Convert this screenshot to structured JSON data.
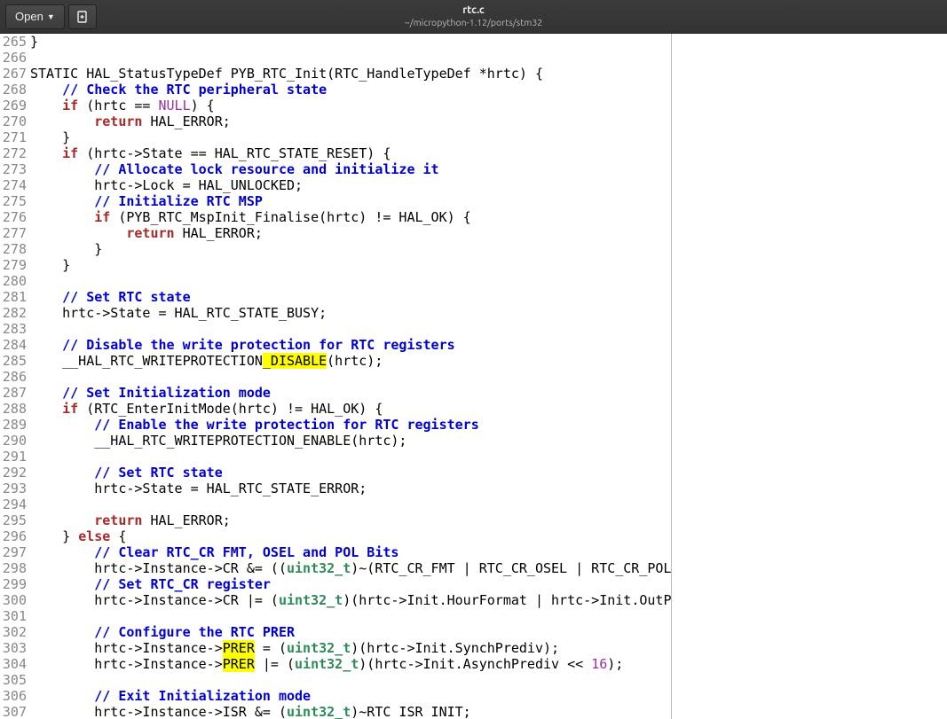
{
  "header": {
    "open_label": "Open",
    "filename": "rtc.c",
    "filepath": "~/micropython-1.12/ports/stm32"
  },
  "lines": [
    {
      "n": "265",
      "segs": [
        {
          "t": "}"
        }
      ]
    },
    {
      "n": "266",
      "segs": []
    },
    {
      "n": "267",
      "segs": [
        {
          "t": "STATIC HAL_StatusTypeDef PYB_RTC_Init(RTC_HandleTypeDef *hrtc) {"
        }
      ]
    },
    {
      "n": "268",
      "segs": [
        {
          "t": "    "
        },
        {
          "t": "// Check the RTC peripheral state",
          "c": "comment"
        }
      ]
    },
    {
      "n": "269",
      "segs": [
        {
          "t": "    "
        },
        {
          "t": "if",
          "c": "kw"
        },
        {
          "t": " (hrtc == "
        },
        {
          "t": "NULL",
          "c": "null"
        },
        {
          "t": ") {"
        }
      ]
    },
    {
      "n": "270",
      "segs": [
        {
          "t": "        "
        },
        {
          "t": "return",
          "c": "ret"
        },
        {
          "t": " HAL_ERROR;"
        }
      ]
    },
    {
      "n": "271",
      "segs": [
        {
          "t": "    }"
        }
      ]
    },
    {
      "n": "272",
      "segs": [
        {
          "t": "    "
        },
        {
          "t": "if",
          "c": "kw"
        },
        {
          "t": " (hrtc->State == HAL_RTC_STATE_RESET) {"
        }
      ]
    },
    {
      "n": "273",
      "segs": [
        {
          "t": "        "
        },
        {
          "t": "// Allocate lock resource and initialize it",
          "c": "comment"
        }
      ]
    },
    {
      "n": "274",
      "segs": [
        {
          "t": "        hrtc->Lock = HAL_UNLOCKED;"
        }
      ]
    },
    {
      "n": "275",
      "segs": [
        {
          "t": "        "
        },
        {
          "t": "// Initialize RTC MSP",
          "c": "comment"
        }
      ]
    },
    {
      "n": "276",
      "segs": [
        {
          "t": "        "
        },
        {
          "t": "if",
          "c": "kw"
        },
        {
          "t": " (PYB_RTC_MspInit_Finalise(hrtc) != HAL_OK) {"
        }
      ]
    },
    {
      "n": "277",
      "segs": [
        {
          "t": "            "
        },
        {
          "t": "return",
          "c": "ret"
        },
        {
          "t": " HAL_ERROR;"
        }
      ]
    },
    {
      "n": "278",
      "segs": [
        {
          "t": "        }"
        }
      ]
    },
    {
      "n": "279",
      "segs": [
        {
          "t": "    }"
        }
      ]
    },
    {
      "n": "280",
      "segs": []
    },
    {
      "n": "281",
      "segs": [
        {
          "t": "    "
        },
        {
          "t": "// Set RTC state",
          "c": "comment"
        }
      ]
    },
    {
      "n": "282",
      "segs": [
        {
          "t": "    hrtc->State = HAL_RTC_STATE_BUSY;"
        }
      ]
    },
    {
      "n": "283",
      "segs": []
    },
    {
      "n": "284",
      "segs": [
        {
          "t": "    "
        },
        {
          "t": "// Disable the write protection for RTC registers",
          "c": "comment"
        }
      ]
    },
    {
      "n": "285",
      "segs": [
        {
          "t": "    __HAL_RTC_WRITEPROTECTION"
        },
        {
          "t": "_DISABLE",
          "c": "hl"
        },
        {
          "t": "(hrtc);"
        }
      ]
    },
    {
      "n": "286",
      "segs": []
    },
    {
      "n": "287",
      "segs": [
        {
          "t": "    "
        },
        {
          "t": "// Set Initialization mode",
          "c": "comment"
        }
      ]
    },
    {
      "n": "288",
      "segs": [
        {
          "t": "    "
        },
        {
          "t": "if",
          "c": "kw"
        },
        {
          "t": " (RTC_EnterInitMode(hrtc) != HAL_OK) {"
        }
      ]
    },
    {
      "n": "289",
      "segs": [
        {
          "t": "        "
        },
        {
          "t": "// Enable the write protection for RTC registers",
          "c": "comment"
        }
      ]
    },
    {
      "n": "290",
      "segs": [
        {
          "t": "        __HAL_RTC_WRITEPROTECTION_ENABLE(hrtc);"
        }
      ]
    },
    {
      "n": "291",
      "segs": []
    },
    {
      "n": "292",
      "segs": [
        {
          "t": "        "
        },
        {
          "t": "// Set RTC state",
          "c": "comment"
        }
      ]
    },
    {
      "n": "293",
      "segs": [
        {
          "t": "        hrtc->State = HAL_RTC_STATE_ERROR;"
        }
      ]
    },
    {
      "n": "294",
      "segs": []
    },
    {
      "n": "295",
      "segs": [
        {
          "t": "        "
        },
        {
          "t": "return",
          "c": "ret"
        },
        {
          "t": " HAL_ERROR;"
        }
      ]
    },
    {
      "n": "296",
      "segs": [
        {
          "t": "    } "
        },
        {
          "t": "else",
          "c": "kw"
        },
        {
          "t": " {"
        }
      ]
    },
    {
      "n": "297",
      "segs": [
        {
          "t": "        "
        },
        {
          "t": "// Clear RTC_CR FMT, OSEL and POL Bits",
          "c": "comment"
        }
      ]
    },
    {
      "n": "298",
      "segs": [
        {
          "t": "        hrtc->Instance->CR &= (("
        },
        {
          "t": "uint32_t",
          "c": "type"
        },
        {
          "t": ")~(RTC_CR_FMT | RTC_CR_OSEL | RTC_CR_POL));"
        }
      ]
    },
    {
      "n": "299",
      "segs": [
        {
          "t": "        "
        },
        {
          "t": "// Set RTC_CR register",
          "c": "comment"
        }
      ]
    },
    {
      "n": "300",
      "segs": [
        {
          "t": "        hrtc->Instance->CR |= ("
        },
        {
          "t": "uint32_t",
          "c": "type"
        },
        {
          "t": ")(hrtc->Init.HourFormat | hrtc->Init.OutPut | hrtc->Init.OutPutPolarity);"
        }
      ]
    },
    {
      "n": "301",
      "segs": []
    },
    {
      "n": "302",
      "segs": [
        {
          "t": "        "
        },
        {
          "t": "// Configure the RTC PRER",
          "c": "comment"
        }
      ]
    },
    {
      "n": "303",
      "segs": [
        {
          "t": "        hrtc->Instance->"
        },
        {
          "t": "PRER",
          "c": "hl"
        },
        {
          "t": " = ("
        },
        {
          "t": "uint32_t",
          "c": "type"
        },
        {
          "t": ")(hrtc->Init.SynchPrediv);"
        }
      ]
    },
    {
      "n": "304",
      "segs": [
        {
          "t": "        hrtc->Instance->"
        },
        {
          "t": "PRER",
          "c": "hl"
        },
        {
          "t": " |= ("
        },
        {
          "t": "uint32_t",
          "c": "type"
        },
        {
          "t": ")(hrtc->Init.AsynchPrediv << "
        },
        {
          "t": "16",
          "c": "num"
        },
        {
          "t": ");"
        }
      ]
    },
    {
      "n": "305",
      "segs": []
    },
    {
      "n": "306",
      "segs": [
        {
          "t": "        "
        },
        {
          "t": "// Exit Initialization mode",
          "c": "comment"
        }
      ]
    },
    {
      "n": "307",
      "segs": [
        {
          "t": "        hrtc->Instance->ISR &= ("
        },
        {
          "t": "uint32_t",
          "c": "type"
        },
        {
          "t": ")~RTC_ISR_INIT;"
        }
      ]
    }
  ]
}
